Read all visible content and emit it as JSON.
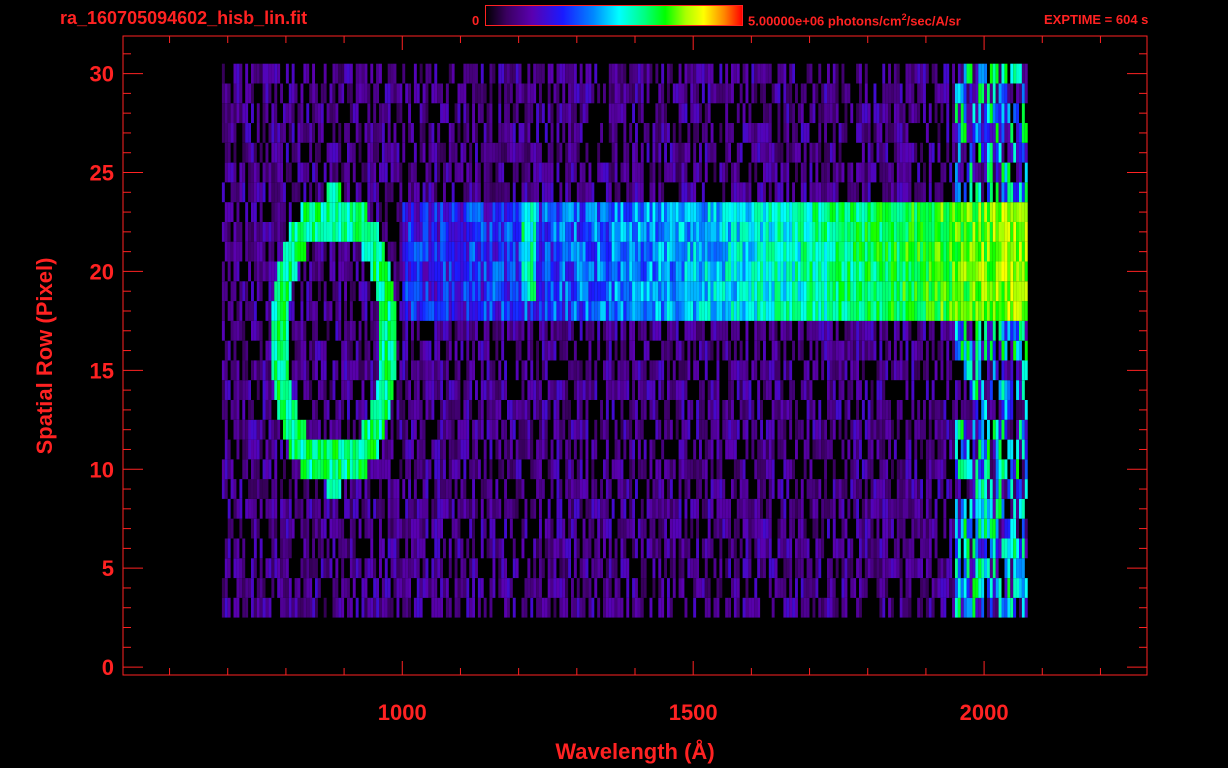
{
  "header": {
    "filename": "ra_160705094602_hisb_lin.fit",
    "colorbar_min": "0",
    "colorbar_max_prefix": "5.00000e+06 photons/cm",
    "colorbar_max_exp": "2",
    "colorbar_max_suffix": "/sec/A/sr",
    "exptime": "EXPTIME = 604 s"
  },
  "colors": {
    "axis": "#ff2222",
    "background": "#000000",
    "colormap": [
      "#000000",
      "#3a0060",
      "#5a00b0",
      "#1a1aff",
      "#0088ff",
      "#00ffff",
      "#00ff80",
      "#00ff00",
      "#aaff00",
      "#ffff00",
      "#ff8800",
      "#ff0000"
    ]
  },
  "chart_data": {
    "type": "heatmap",
    "title": "ra_160705094602_hisb_lin.fit",
    "xlabel": "Wavelength (Å)",
    "ylabel": "Spatial Row (Pixel)",
    "xlim": [
      520,
      2280
    ],
    "ylim": [
      -0.4,
      31.9
    ],
    "x_ticks": [
      1000,
      1500,
      2000
    ],
    "y_ticks": [
      0,
      5,
      10,
      15,
      20,
      25,
      30
    ],
    "colorbar_range": [
      0,
      5000000
    ],
    "colorbar_units": "photons/cm^2/sec/A/sr",
    "exptime_s": 604,
    "data_extent": {
      "x": [
        690,
        2075
      ],
      "y_rows": [
        3,
        30
      ]
    },
    "features": {
      "ring": {
        "center_wavelength": 880,
        "center_row": 16.5,
        "half_width": 95,
        "half_height": 6.5,
        "level": 0.55
      },
      "line_1216": {
        "wavelength": 1216,
        "rows": [
          21,
          23
        ],
        "level": 0.55
      },
      "continuum_band": {
        "wavelength_range": [
          1000,
          2075
        ],
        "rows": [
          18,
          23
        ],
        "level_start": 0.3,
        "level_end": 0.8
      },
      "red_edge": {
        "wavelength_range": [
          1950,
          2075
        ],
        "level": 0.45
      }
    }
  }
}
